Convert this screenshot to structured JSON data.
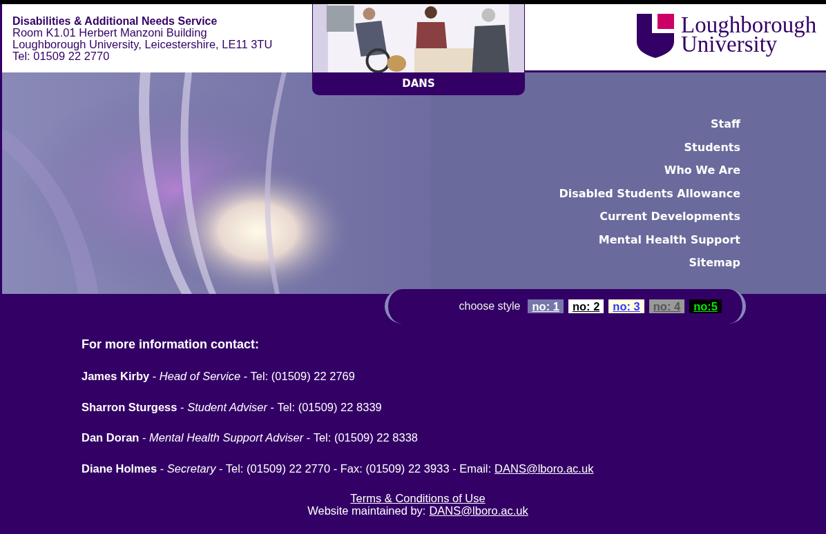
{
  "header": {
    "service_name": "Disabilities & Additional Needs Service",
    "address_lines": [
      "Room K1.01 Herbert Manzoni Building",
      "Loughborough University, Leicestershire, LE11 3TU",
      "Tel: 01509 22 2770"
    ],
    "photo": {
      "kind": "picture"
    },
    "tab_label": "DANS",
    "logo_lines": [
      "Loughborough",
      "University"
    ]
  },
  "nav": [
    "Staff",
    "Students",
    "Who We Are",
    "Disabled Students Allowance",
    "Current Developments",
    "Mental Health Support",
    "Sitemap"
  ],
  "style_chooser": {
    "label": "choose style",
    "options": [
      {
        "label": "no: 1",
        "kind": "lavender"
      },
      {
        "label": "no: 2",
        "kind": "white"
      },
      {
        "label": "no: 3",
        "kind": "cream"
      },
      {
        "label": "no: 4",
        "kind": "grey"
      },
      {
        "label": "no:5",
        "kind": "black"
      }
    ]
  },
  "contact": {
    "heading": "For more information contact:",
    "lines": [
      {
        "text": "**James Kirby** - *Head of Service* - Tel: (01509) 22 2769"
      },
      {
        "text": "**Sharron Sturgess** - *Student Adviser* - Tel: (01509) 22 8339"
      },
      {
        "text": "**Dan Doran** - *Mental Health Support Adviser* - Tel: (01509) 22 8338"
      },
      {
        "text": "**Diane Holmes** - *Secretary* - Tel: (01509) 22 2770 - Fax: (01509) 22 3933 - Email:",
        "email": "DANS@lboro.ac.uk"
      }
    ]
  },
  "footer": {
    "terms_link": "Terms & Conditions of Use",
    "maintained_label": "Website maintained by:",
    "maintained_email": "DANS@lboro.ac.uk"
  }
}
